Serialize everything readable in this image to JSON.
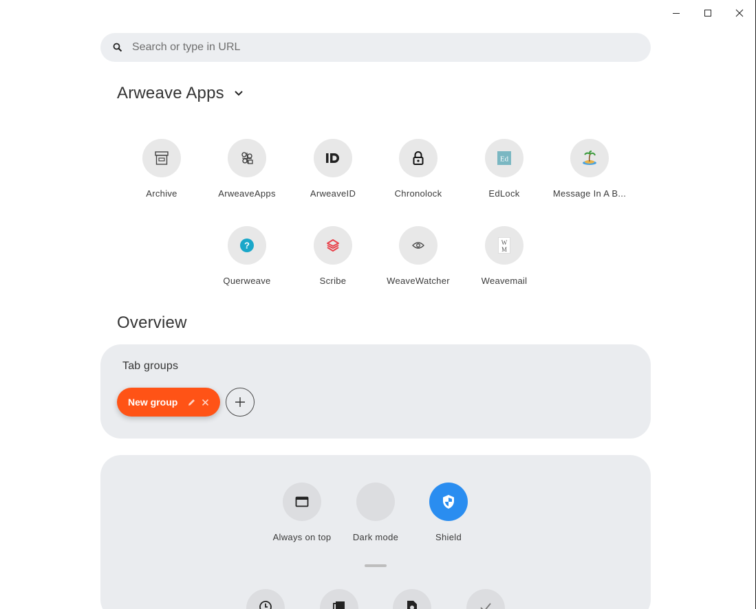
{
  "window": {
    "controls": [
      {
        "name": "minimize-icon",
        "label": "minimize"
      },
      {
        "name": "maximize-icon",
        "label": "maximize"
      },
      {
        "name": "close-icon",
        "label": "close"
      }
    ]
  },
  "search": {
    "placeholder": "Search or type in URL",
    "value": ""
  },
  "apps_section": {
    "title": "Arweave Apps",
    "apps": [
      {
        "label": "Archive",
        "icon": "archive-box-icon"
      },
      {
        "label": "ArweaveApps",
        "icon": "arweaveapps-logo-icon"
      },
      {
        "label": "ArweaveID",
        "icon": "id-badge-icon"
      },
      {
        "label": "Chronolock",
        "icon": "padlock-icon"
      },
      {
        "label": "EdLock",
        "icon": "edlock-logo-icon"
      },
      {
        "label": "Message In A B...",
        "icon": "island-icon"
      },
      {
        "label": "Querweave",
        "icon": "question-circle-icon"
      },
      {
        "label": "Scribe",
        "icon": "scribe-logo-icon"
      },
      {
        "label": "WeaveWatcher",
        "icon": "eye-icon"
      },
      {
        "label": "Weavemail",
        "icon": "weavemail-logo-icon"
      }
    ]
  },
  "overview": {
    "title": "Overview",
    "tab_groups": {
      "label": "Tab groups",
      "groups": [
        {
          "label": "New group",
          "color": "#ff5316"
        }
      ],
      "add_icon": "plus-icon"
    }
  },
  "tools": {
    "items": [
      {
        "label": "Always on top",
        "icon": "window-icon",
        "active": false
      },
      {
        "label": "Dark mode",
        "icon": "moon-icon",
        "active": false
      },
      {
        "label": "Shield",
        "icon": "shield-icon",
        "active": true
      }
    ],
    "accent": "#2a8df0",
    "row2_icons": [
      "clock-icon",
      "copy-icon",
      "file-icon",
      "check-icon"
    ]
  }
}
